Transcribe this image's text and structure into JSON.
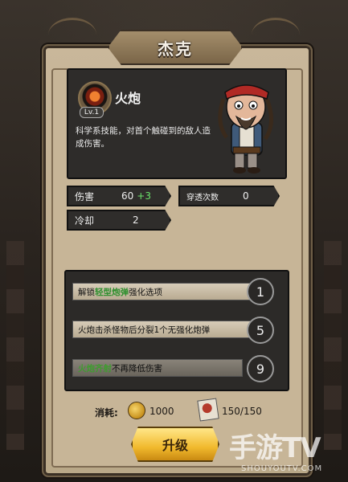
{
  "title": "杰克",
  "skill": {
    "level_badge": "Lv.1",
    "name": "火炮",
    "description": "科学系技能，对首个触碰到的敌人造成伤害。"
  },
  "stats": {
    "damage": {
      "label": "伤害",
      "value": "60",
      "bonus": "+3"
    },
    "pierce": {
      "label": "穿透次数",
      "value": "0"
    },
    "cooldown": {
      "label": "冷却",
      "value": "2"
    }
  },
  "upgrades": [
    {
      "pre": "解锁",
      "highlight": "轻型炮弹",
      "post": "强化选项",
      "number": "1"
    },
    {
      "pre": "火炮击杀怪物后分裂1个无强化炮弹",
      "highlight": "",
      "post": "",
      "number": "5"
    },
    {
      "pre": "",
      "highlight": "火炮齐射",
      "post": "不再降低伤害",
      "number": "9"
    }
  ],
  "cost": {
    "label": "消耗:",
    "coins": "1000",
    "cards": "150/150"
  },
  "button": {
    "upgrade_label": "升级"
  },
  "watermark": {
    "main": "手游TV",
    "sub": "SHOUYOUTV.COM"
  },
  "colors": {
    "highlight_green": "#2e8f2e",
    "button_gold": "#f1b92d"
  }
}
